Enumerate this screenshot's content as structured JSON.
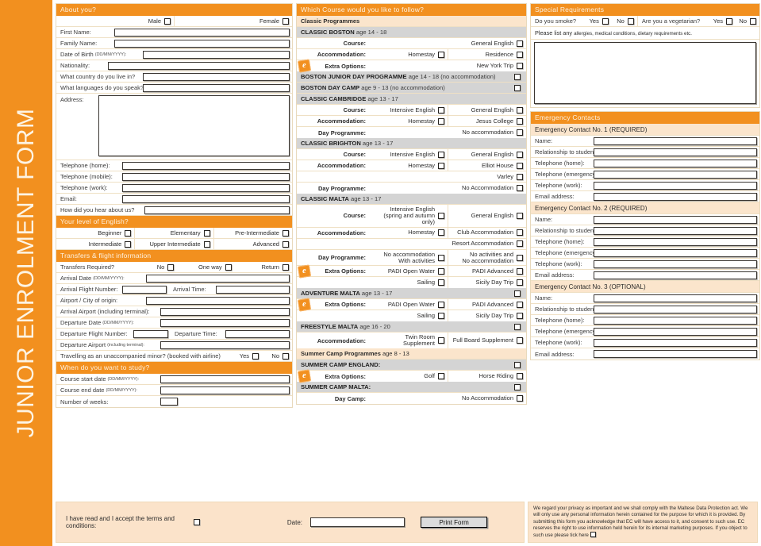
{
  "spine_title": "JUNIOR ENROLMENT FORM",
  "colors": {
    "orange": "#F2901F",
    "cream": "#FBE5CC",
    "grey": "#D4D4D4"
  },
  "about": {
    "header": "About you?",
    "male": "Male",
    "female": "Female",
    "first_name": "First Name:",
    "family_name": "Family Name:",
    "dob": "Date of Birth",
    "dob_hint": "(DD/MM/YYYY):",
    "nationality": "Nationality:",
    "country": "What country do you live in?",
    "languages": "What languages do you speak?",
    "address": "Address:",
    "tel_home": "Telephone  (home):",
    "tel_mobile": "Telephone (mobile):",
    "tel_work": "Telephone (work):",
    "email": "Email:",
    "hear": "How did you hear about us?"
  },
  "english": {
    "header": "Your level of English?",
    "levels": [
      "Beginner",
      "Elementary",
      "Pre-Intermediate",
      "Intermediate",
      "Upper Intermediate",
      "Advanced"
    ]
  },
  "transfers": {
    "header": "Transfers & flight information",
    "required_label": "Transfers Required?",
    "required_options": [
      "No",
      "One way",
      "Return"
    ],
    "arrival_date": "Arrival Date",
    "arrival_date_hint": "(DD/MM/YYYY):",
    "arrival_flight": "Arrival Flight Number:",
    "arrival_time": "Arrival Time:",
    "airport_origin": "Airport / City of origin:",
    "arrival_airport": "Arrival Airport (including terminal):",
    "departure_date": "Departure Date",
    "departure_date_hint": "(DD/MM/YYYY):",
    "departure_flight": "Departure Flight Number:",
    "departure_time": "Departure Time:",
    "departure_airport": "Departure Airport",
    "departure_airport_hint": "(including terminal):",
    "minor": "Travelling as an unaccompanied minor? (booked with airline)",
    "minor_yes": "Yes",
    "minor_no": "No"
  },
  "study": {
    "header": "When do you want to study?",
    "start": "Course start date",
    "start_hint": "(DD/MM/YYYY):",
    "end": "Course end date",
    "end_hint": "(DD/MM/YYYY):",
    "weeks": "Number of weeks:"
  },
  "course": {
    "header": "Which Course would you like to follow?",
    "classic_label": "Classic Programmes",
    "summer_label": "Summer Camp Programmes",
    "summer_age": "age 8 - 13",
    "programmes": [
      {
        "name": "CLASSIC BOSTON",
        "age": "age 14 - 18",
        "has_header_box": false,
        "rows": [
          {
            "label": "Course:",
            "badge": false,
            "cells": [
              {
                "text": "General English",
                "wide": true
              }
            ]
          },
          {
            "label": "Accommodation:",
            "badge": false,
            "cells": [
              {
                "text": "Homestay"
              },
              {
                "text": "Residence"
              }
            ]
          },
          {
            "label": "Extra Options:",
            "badge": true,
            "cells": [
              {
                "text": "New York Trip",
                "wide": true
              }
            ]
          }
        ]
      },
      {
        "name": "BOSTON JUNIOR DAY PROGRAMME",
        "age": "age 14 - 18 (no accommodation)",
        "has_header_box": true,
        "rows": []
      },
      {
        "name": "BOSTON DAY CAMP",
        "age": "age 9 - 13 (no accommodation)",
        "has_header_box": true,
        "rows": []
      },
      {
        "name": "CLASSIC CAMBRIDGE",
        "age": "age 13 - 17",
        "has_header_box": false,
        "rows": [
          {
            "label": "Course:",
            "badge": false,
            "cells": [
              {
                "text": "Intensive English"
              },
              {
                "text": "General English"
              }
            ]
          },
          {
            "label": "Accommodation:",
            "badge": false,
            "cells": [
              {
                "text": "Homestay"
              },
              {
                "text": "Jesus College"
              }
            ]
          },
          {
            "label": "Day Programme:",
            "badge": false,
            "cells": [
              {
                "text": "No accommodation",
                "wide": true
              }
            ]
          }
        ]
      },
      {
        "name": "CLASSIC BRIGHTON",
        "age": "age 13 - 17",
        "has_header_box": false,
        "rows": [
          {
            "label": "Course:",
            "badge": false,
            "cells": [
              {
                "text": "Intensive English"
              },
              {
                "text": "General English"
              }
            ]
          },
          {
            "label": "Accommodation:",
            "badge": false,
            "cells": [
              {
                "text": "Homestay"
              },
              {
                "text": "Elliot House"
              }
            ]
          },
          {
            "label": "",
            "badge": false,
            "cells": [
              {
                "text": "Varley",
                "wide": true
              }
            ]
          },
          {
            "label": "Day Programme:",
            "badge": false,
            "cells": [
              {
                "text": "No Accommodation",
                "wide": true
              }
            ]
          }
        ]
      },
      {
        "name": "CLASSIC MALTA",
        "age": "age 13 - 17",
        "has_header_box": false,
        "rows": [
          {
            "label": "Course:",
            "badge": false,
            "cells": [
              {
                "text": "Intensive English\n(spring and autumn only)"
              },
              {
                "text": "General English"
              }
            ]
          },
          {
            "label": "Accommodation:",
            "badge": false,
            "cells": [
              {
                "text": "Homestay"
              },
              {
                "text": "Club Accommodation"
              }
            ]
          },
          {
            "label": "",
            "badge": false,
            "cells": [
              {
                "text": "Resort Accommodation",
                "wide": true
              }
            ]
          },
          {
            "label": "Day Programme:",
            "badge": false,
            "cells": [
              {
                "text": "No accommodation\nWith activities"
              },
              {
                "text": "No activities and\nNo accommodation"
              }
            ]
          },
          {
            "label": "Extra Options:",
            "badge": true,
            "cells": [
              {
                "text": "PADI Open Water"
              },
              {
                "text": "PADI Advanced"
              }
            ]
          },
          {
            "label": "",
            "badge": false,
            "cells": [
              {
                "text": "Sailing"
              },
              {
                "text": "Sicily Day Trip"
              }
            ]
          }
        ]
      },
      {
        "name": "ADVENTURE MALTA",
        "age": "age 13 - 17",
        "has_header_box": true,
        "rows": [
          {
            "label": "Extra Options:",
            "badge": true,
            "cells": [
              {
                "text": "PADI Open Water"
              },
              {
                "text": "PADI Advanced"
              }
            ]
          },
          {
            "label": "",
            "badge": false,
            "cells": [
              {
                "text": "Sailing"
              },
              {
                "text": "Sicily Day Trip"
              }
            ]
          }
        ]
      },
      {
        "name": "FREESTYLE MALTA",
        "age": "age 16 - 20",
        "has_header_box": true,
        "rows": [
          {
            "label": "Accommodation:",
            "badge": false,
            "cells": [
              {
                "text": "Twin Room Supplement"
              },
              {
                "text": "Full Board Supplement"
              }
            ]
          }
        ]
      }
    ],
    "summer_programmes": [
      {
        "name": "SUMMER CAMP ENGLAND:",
        "age": "",
        "has_header_box": true,
        "rows": [
          {
            "label": "Extra Options:",
            "badge": true,
            "cells": [
              {
                "text": "Golf"
              },
              {
                "text": "Horse Riding"
              }
            ]
          }
        ]
      },
      {
        "name": "SUMMER CAMP MALTA:",
        "age": "",
        "has_header_box": true,
        "rows": [
          {
            "label": "Day Camp:",
            "badge": false,
            "cells": [
              {
                "text": "No Accommodation",
                "wide": true
              }
            ]
          }
        ]
      }
    ]
  },
  "special": {
    "header": "Special Requirements",
    "smoke": "Do you smoke?",
    "smoke_yes": "Yes",
    "smoke_no": "No",
    "veg": "Are you a vegetarian?",
    "veg_yes": "Yes",
    "veg_no": "No",
    "list_prefix": "Please list any ",
    "list_rest": "allergies, medical conditions, dietary requirements etc."
  },
  "emergency": {
    "header": "Emergency Contacts",
    "contacts": [
      {
        "title": "Emergency Contact No. 1 (REQUIRED)"
      },
      {
        "title": "Emergency Contact No. 2 (REQUIRED)"
      },
      {
        "title": "Emergency Contact No. 3 (OPTIONAL)"
      }
    ],
    "fields": [
      "Name:",
      "Relationship to student:",
      "Telephone (home):",
      "Telephone (emergency):",
      "Telephone (work):",
      "Email address:"
    ]
  },
  "footer": {
    "terms": "I have read and I accept the terms and conditions:",
    "date": "Date:",
    "print": "Print Form",
    "privacy": "We regard your privacy as important and we shall comply with the Maltese Data Protection act. We will only use any personal information herein contained for the purpose for which it is provided. By submitting this form you acknowledge that EC will have access to it, and consent to such use. EC reserves the right to use information held herein for its internal marketing purposes. If you object to such use please tick here"
  }
}
